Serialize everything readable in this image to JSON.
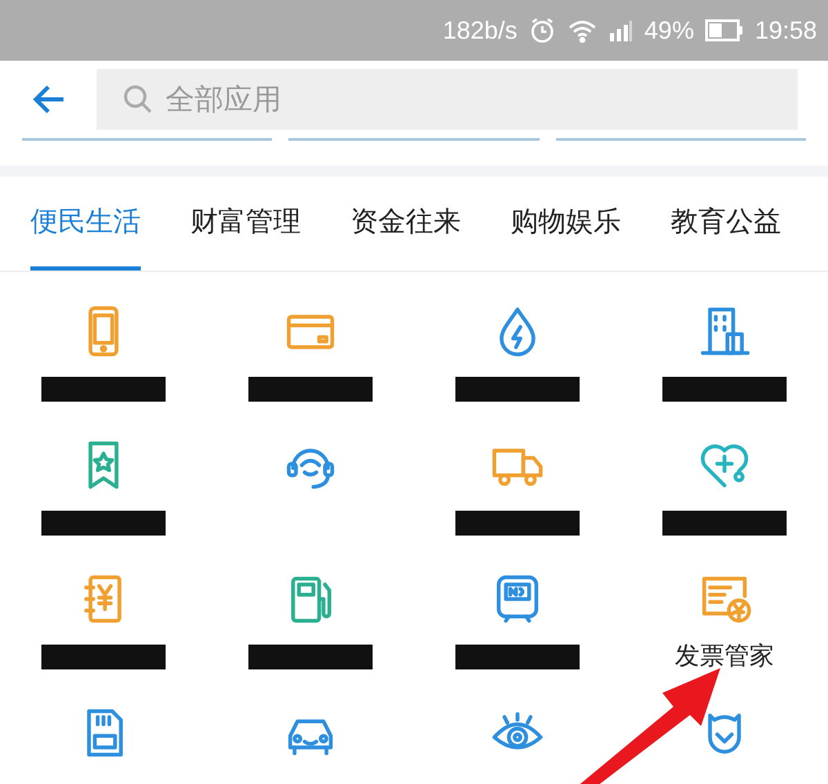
{
  "status_bar": {
    "speed": "182b/s",
    "battery": "49%",
    "time": "19:58"
  },
  "search": {
    "placeholder": "全部应用"
  },
  "tabs": [
    {
      "label": "便民生活",
      "selected": true
    },
    {
      "label": "财富管理",
      "selected": false
    },
    {
      "label": "资金往来",
      "selected": false
    },
    {
      "label": "购物娱乐",
      "selected": false
    },
    {
      "label": "教育公益",
      "selected": false
    }
  ],
  "apps": [
    {
      "kind": "phone",
      "redacted": true
    },
    {
      "kind": "card",
      "redacted": true
    },
    {
      "kind": "water",
      "redacted": true
    },
    {
      "kind": "building",
      "redacted": true
    },
    {
      "kind": "bookmark",
      "redacted": true
    },
    {
      "kind": "headset",
      "redacted": false
    },
    {
      "kind": "truck",
      "redacted": true
    },
    {
      "kind": "medical",
      "redacted": true
    },
    {
      "kind": "ledger",
      "redacted": true
    },
    {
      "kind": "fuel",
      "redacted": true
    },
    {
      "kind": "bus",
      "redacted": true
    },
    {
      "kind": "invoice",
      "label": "发票管家",
      "redacted": false
    },
    {
      "kind": "sim",
      "redacted": false
    },
    {
      "kind": "car",
      "redacted": false
    },
    {
      "kind": "eye",
      "redacted": false
    },
    {
      "kind": "shield",
      "redacted": false
    }
  ]
}
